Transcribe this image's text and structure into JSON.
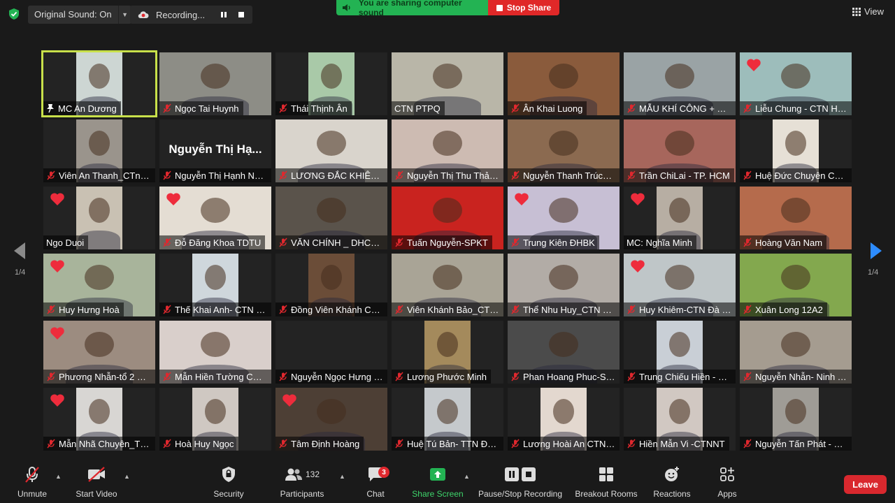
{
  "topbar": {
    "sound_label": "Original Sound: On",
    "recording_label": "Recording...",
    "sharing_label": "You are sharing computer sound",
    "stop_share_label": "Stop Share",
    "view_label": "View"
  },
  "pagination": {
    "left": "1/4",
    "right": "1/4"
  },
  "participants": [
    {
      "name": "MC An Dương",
      "tone": "#cdd6d3",
      "style": "center",
      "mic": "pin",
      "active": true
    },
    {
      "name": "Ngọc Tai Huynh",
      "tone": "#8d8d86",
      "style": "full",
      "mic": "muted"
    },
    {
      "name": "Thái Thịnh Ân",
      "tone": "#a9c9a8",
      "style": "center",
      "mic": "muted"
    },
    {
      "name": "CTN PTPQ",
      "tone": "#b9b6a8",
      "style": "full",
      "mic": "none"
    },
    {
      "name": "Ân Khai Luong",
      "tone": "#8a5b3c",
      "style": "full",
      "mic": "muted"
    },
    {
      "name": "MẪU KHÍ CÔNG + THI...",
      "tone": "#9aa3a5",
      "style": "full",
      "mic": "muted"
    },
    {
      "name": "Liễu Chung - CTN HCM",
      "tone": "#9dbdbb",
      "style": "full",
      "mic": "muted",
      "heart": true
    },
    {
      "name": "Viên An Thanh_CTn Đà...",
      "tone": "#9a948c",
      "style": "center",
      "mic": "muted"
    },
    {
      "name": "Nguyễn Thị Hạnh Ngu...",
      "tone": "#232323",
      "style": "none",
      "mic": "muted",
      "bigname": "Nguyễn Thị Hạ..."
    },
    {
      "name": "LƯƠNG ĐẮC KHIÊM-C...",
      "tone": "#d9d4cc",
      "style": "full",
      "mic": "muted"
    },
    {
      "name": "Nguyễn Thị Thu Thảo ...",
      "tone": "#cdbbb2",
      "style": "full",
      "mic": "muted"
    },
    {
      "name": "Nguyễn Thanh Trúc_S...",
      "tone": "#8b6a50",
      "style": "full",
      "mic": "muted"
    },
    {
      "name": "Trần ChiLai - TP. HCM",
      "tone": "#a7665c",
      "style": "full",
      "mic": "muted"
    },
    {
      "name": "Huệ Đức Chuyên CTN ...",
      "tone": "#e6e0d6",
      "style": "center",
      "mic": "muted"
    },
    {
      "name": "Ngo Duoi",
      "tone": "#c9c1b3",
      "style": "center",
      "mic": "none",
      "heart": true
    },
    {
      "name": "Đỗ Đăng Khoa TDTU",
      "tone": "#e4ddd3",
      "style": "full",
      "mic": "muted",
      "heart": true
    },
    {
      "name": "VĂN CHÍNH _ DHCN (I...",
      "tone": "#5a534b",
      "style": "full",
      "mic": "muted"
    },
    {
      "name": "Tuấn Nguyễn-SPKT",
      "tone": "#c9231f",
      "style": "full",
      "mic": "muted"
    },
    {
      "name": "Trung Kiên ĐHBK",
      "tone": "#c7bfd4",
      "style": "full",
      "mic": "muted",
      "heart": true
    },
    {
      "name": "MC: Nghĩa Minh",
      "tone": "#b7aea3",
      "style": "center",
      "mic": "none",
      "heart": true
    },
    {
      "name": "Hoàng Văn Nam",
      "tone": "#b56b4c",
      "style": "full",
      "mic": "muted"
    },
    {
      "name": "Huy Hưng Hoà",
      "tone": "#a8b49b",
      "style": "full",
      "mic": "muted",
      "heart": true
    },
    {
      "name": "Thế Khai Anh- CTN Vĩ...",
      "tone": "#cfd7dc",
      "style": "center",
      "mic": "muted"
    },
    {
      "name": "Đồng Viên Khánh CTN...",
      "tone": "#6b4d38",
      "style": "center",
      "mic": "muted"
    },
    {
      "name": "Viên Khánh Bảo_CTN ...",
      "tone": "#a9a496",
      "style": "full",
      "mic": "muted"
    },
    {
      "name": "Thể Nhu Huy_CTN TP...",
      "tone": "#b2aca6",
      "style": "full",
      "mic": "muted"
    },
    {
      "name": "Huy Khiêm-CTN Đà Lạt",
      "tone": "#bfc6c8",
      "style": "full",
      "mic": "muted",
      "heart": true
    },
    {
      "name": "Xuân Long 12A2",
      "tone": "#83a84e",
      "style": "full",
      "mic": "muted"
    },
    {
      "name": "Phương Nhẫn-tổ 2 CTN",
      "tone": "#9c8c80",
      "style": "full",
      "mic": "muted",
      "heart": true
    },
    {
      "name": "Mẫn Hiền Tường CTN ...",
      "tone": "#d9cfcb",
      "style": "full",
      "mic": "muted"
    },
    {
      "name": "Nguyễn Ngọc Hưng -S...",
      "tone": "#232323",
      "style": "none",
      "mic": "muted"
    },
    {
      "name": "Lương Phước Minh",
      "tone": "#a48a5c",
      "style": "center",
      "mic": "muted"
    },
    {
      "name": "Phan Hoang Phuc-SPKT",
      "tone": "#4b4b4b",
      "style": "full",
      "mic": "muted"
    },
    {
      "name": "Trung Chiếu Hiền - CT...",
      "tone": "#c9cfd6",
      "style": "center",
      "mic": "muted"
    },
    {
      "name": "Nguyễn Nhẫn- Ninh T...",
      "tone": "#a59c90",
      "style": "full",
      "mic": "muted"
    },
    {
      "name": "Mẫn Nhã Chuyên_Tổ 3...",
      "tone": "#d8d6d3",
      "style": "center",
      "mic": "muted",
      "heart": true
    },
    {
      "name": "Hoà Huy Ngọc",
      "tone": "#cfc8c2",
      "style": "center",
      "mic": "muted"
    },
    {
      "name": "Tâm Định Hoàng",
      "tone": "#4d3f35",
      "style": "full",
      "mic": "muted",
      "heart": true
    },
    {
      "name": "Huệ Tú Bản- TTN Đức-...",
      "tone": "#c5c9cc",
      "style": "center",
      "mic": "muted"
    },
    {
      "name": "Lương Hoài An CTNM...",
      "tone": "#e3d8cf",
      "style": "center",
      "mic": "muted"
    },
    {
      "name": "Hiền Mẫn Vi -CTNNT",
      "tone": "#d1c8c2",
      "style": "center",
      "mic": "muted"
    },
    {
      "name": "Nguyễn Tấn Phát - 20...",
      "tone": "#9f9c96",
      "style": "center",
      "mic": "muted"
    }
  ],
  "toolbar": {
    "unmute": "Unmute",
    "start_video": "Start Video",
    "security": "Security",
    "participants": "Participants",
    "participants_count": "132",
    "chat": "Chat",
    "chat_badge": "3",
    "share_screen": "Share Screen",
    "pause_recording": "Pause/Stop Recording",
    "breakout_rooms": "Breakout Rooms",
    "reactions": "Reactions",
    "apps": "Apps",
    "leave": "Leave"
  },
  "colors": {
    "background": "#1a1a1a",
    "share_green": "#23b353",
    "stop_red": "#e02828",
    "active_speaker": "#c8e04a",
    "muted_red": "#e0282e",
    "arrow_blue": "#2d8cff"
  }
}
